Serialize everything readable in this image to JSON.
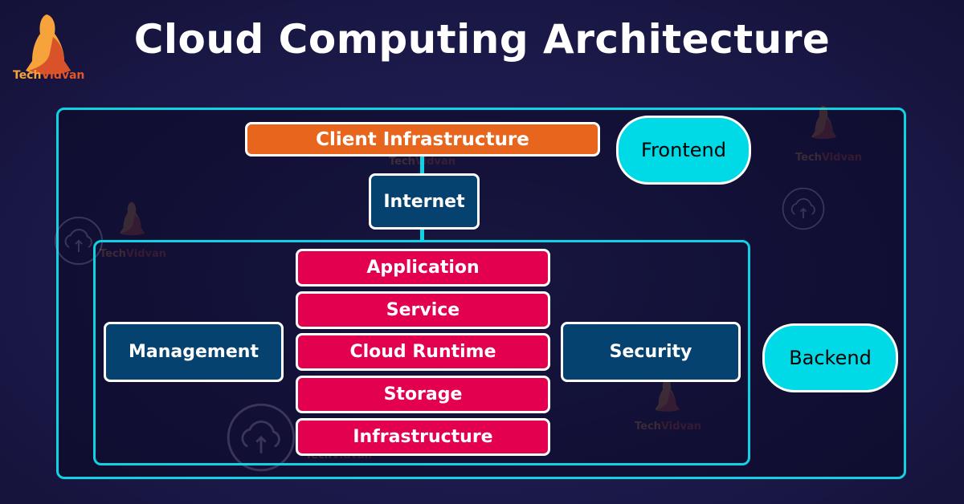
{
  "header": {
    "title": "Cloud Computing Architecture",
    "brand_part1": "Tech",
    "brand_part2": "Vidvan"
  },
  "diagram": {
    "frontend": {
      "label": "Frontend",
      "client_infrastructure": "Client Infrastructure"
    },
    "network": {
      "label": "Internet"
    },
    "backend": {
      "label": "Backend",
      "management": "Management",
      "security": "Security",
      "layers": [
        "Application",
        "Service",
        "Cloud Runtime",
        "Storage",
        "Infrastructure"
      ]
    }
  },
  "watermarks": {
    "brand_part1": "Tech",
    "brand_part2": "Vidvan"
  },
  "colors": {
    "frame": "#10d2e3",
    "client_box": "#e8651e",
    "navy_box": "#05426f",
    "layer_box": "#e3004f",
    "pill": "#00d9e6"
  }
}
